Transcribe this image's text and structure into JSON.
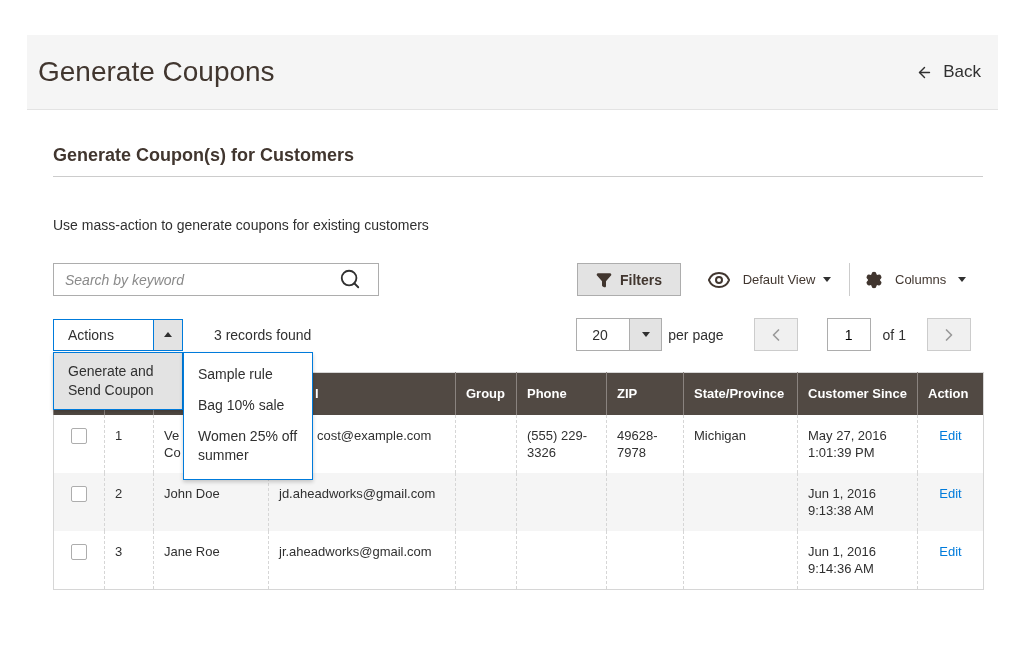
{
  "page": {
    "title": "Generate Coupons",
    "back": "Back"
  },
  "section": {
    "title": "Generate Coupon(s) for Customers",
    "description": "Use mass-action to generate coupons for existing customers"
  },
  "search": {
    "placeholder": "Search by keyword"
  },
  "toolbar": {
    "filters": "Filters",
    "view": "Default View",
    "columns": "Columns"
  },
  "actions": {
    "label": "Actions",
    "expanded": true,
    "items": [
      {
        "label": "Generate and Send Coupon",
        "selected": true,
        "submenu": [
          "Sample rule",
          "Bag 10% sale",
          "Women 25% off summer"
        ]
      }
    ]
  },
  "records": "3 records found",
  "pager": {
    "per_page": "20",
    "per_page_label": "per page",
    "page": "1",
    "of": "of 1"
  },
  "table": {
    "columns": [
      {
        "kind": "covered"
      },
      {
        "kind": "covered"
      },
      {
        "kind": "covered"
      },
      {
        "kind": "clipped",
        "label": "l"
      },
      {
        "kind": "text",
        "label": "Group"
      },
      {
        "kind": "text",
        "label": "Phone"
      },
      {
        "kind": "text",
        "label": "ZIP"
      },
      {
        "kind": "text",
        "label": "State/Province"
      },
      {
        "kind": "text",
        "label": "Customer Since"
      },
      {
        "kind": "text",
        "label": "Action"
      }
    ],
    "rows": [
      {
        "cells": [
          {
            "kind": "checkbox",
            "checked": false
          },
          {
            "text": "1"
          },
          {
            "text": "Ve\nCo"
          },
          {
            "text": "cost@example.com",
            "kind": "clipped"
          },
          {},
          {
            "text": "(555) 229-3326"
          },
          {
            "text": "49628-7978"
          },
          {
            "text": "Michigan"
          },
          {
            "text": "May 27, 2016 1:01:39 PM"
          },
          {
            "text": "Edit",
            "kind": "link"
          }
        ]
      },
      {
        "cells": [
          {
            "kind": "checkbox",
            "checked": false
          },
          {
            "text": "2"
          },
          {
            "text": "John Doe"
          },
          {
            "text": "jd.aheadworks@gmail.com"
          },
          {},
          {},
          {},
          {},
          {
            "text": "Jun 1, 2016 9:13:38 AM"
          },
          {
            "text": "Edit",
            "kind": "link"
          }
        ]
      },
      {
        "cells": [
          {
            "kind": "checkbox",
            "checked": false
          },
          {
            "text": "3"
          },
          {
            "text": "Jane Roe"
          },
          {
            "text": "jr.aheadworks@gmail.com"
          },
          {},
          {},
          {},
          {},
          {
            "text": "Jun 1, 2016 9:14:36 AM"
          },
          {
            "text": "Edit",
            "kind": "link"
          }
        ]
      }
    ]
  }
}
